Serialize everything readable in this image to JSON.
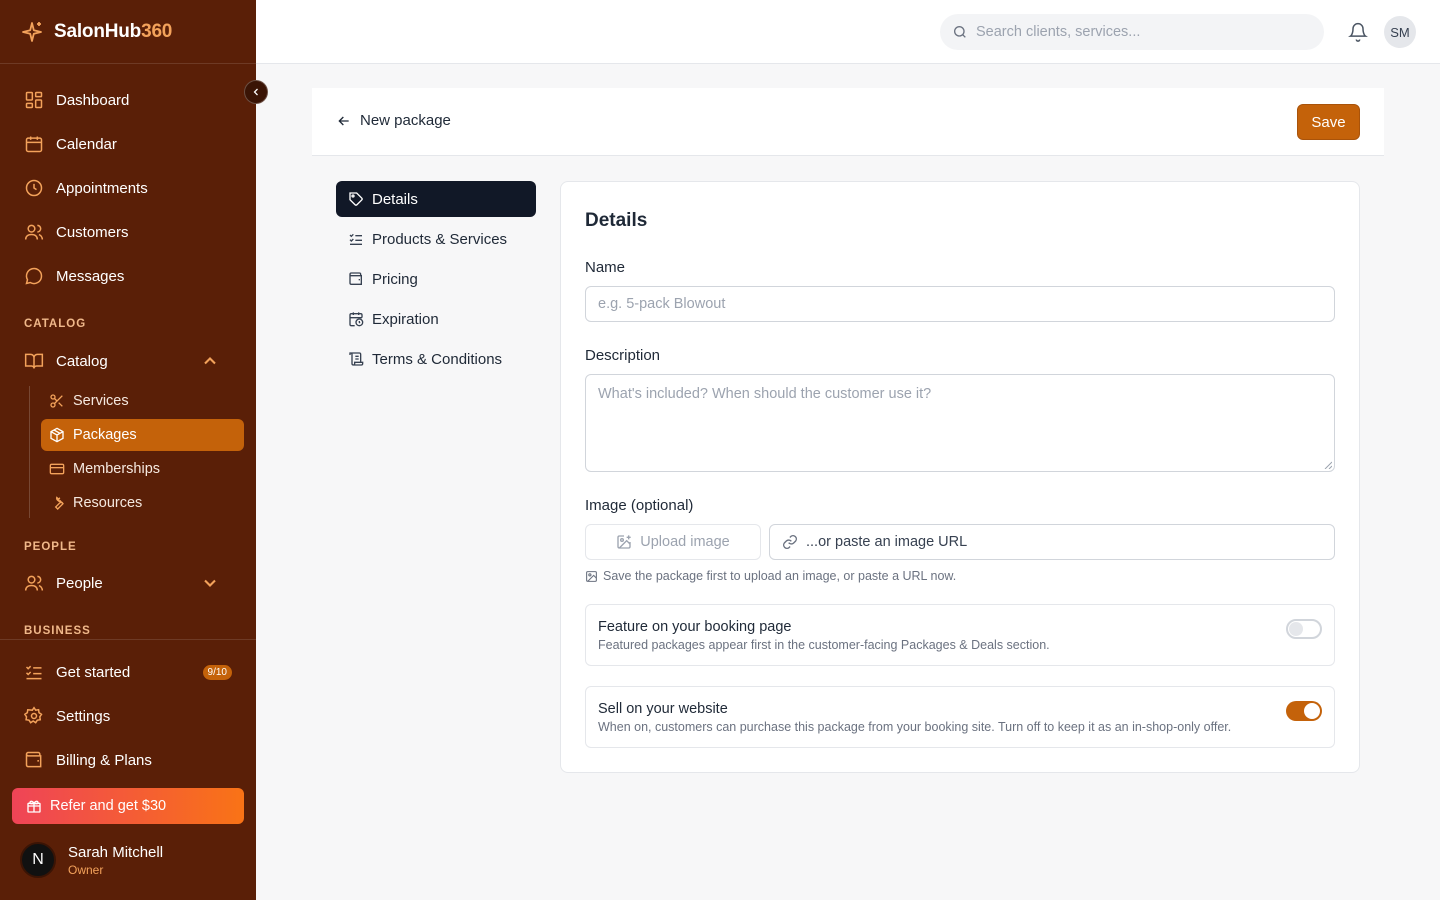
{
  "brand": {
    "name": "SalonHub",
    "suffix": "360"
  },
  "colors": {
    "sidebar": "#5a1f07",
    "accent": "#c4620a",
    "active_tab": "#111827",
    "refer_gradient": [
      "#ef4457",
      "#f97316"
    ]
  },
  "sidebar": {
    "main": [
      {
        "label": "Dashboard",
        "icon": "grid-icon"
      },
      {
        "label": "Calendar",
        "icon": "calendar-icon"
      },
      {
        "label": "Appointments",
        "icon": "clock-icon"
      },
      {
        "label": "Customers",
        "icon": "users-icon"
      },
      {
        "label": "Messages",
        "icon": "message-icon"
      }
    ],
    "catalog_section": "CATALOG",
    "catalog_label": "Catalog",
    "catalog_sub": [
      {
        "label": "Services",
        "icon": "scissors-icon"
      },
      {
        "label": "Packages",
        "icon": "package-icon",
        "active": true
      },
      {
        "label": "Memberships",
        "icon": "card-icon"
      },
      {
        "label": "Resources",
        "icon": "wrench-icon"
      }
    ],
    "people_section": "PEOPLE",
    "people_label": "People",
    "business_section": "BUSINESS",
    "business": [
      {
        "label": "Get started",
        "icon": "checklist-icon",
        "badge": "9/10"
      },
      {
        "label": "Settings",
        "icon": "gear-icon"
      },
      {
        "label": "Billing & Plans",
        "icon": "wallet-icon"
      }
    ],
    "refer": "Refer and get $30",
    "user": {
      "initial": "N",
      "name": "Sarah Mitchell",
      "role": "Owner"
    }
  },
  "topbar": {
    "search_placeholder": "Search clients, services...",
    "avatar": "SM"
  },
  "page": {
    "title": "New package",
    "save": "Save"
  },
  "tabs": [
    {
      "label": "Details",
      "icon": "tag-icon",
      "active": true
    },
    {
      "label": "Products & Services",
      "icon": "list-check-icon"
    },
    {
      "label": "Pricing",
      "icon": "wallet-icon"
    },
    {
      "label": "Expiration",
      "icon": "calendar-clock-icon"
    },
    {
      "label": "Terms & Conditions",
      "icon": "scroll-icon"
    }
  ],
  "form": {
    "heading": "Details",
    "name_label": "Name",
    "name_placeholder": "e.g. 5-pack Blowout",
    "desc_label": "Description",
    "desc_placeholder": "What's included? When should the customer use it?",
    "image_label": "Image (optional)",
    "upload": "Upload image",
    "url_placeholder": "...or paste an image URL",
    "hint": "Save the package first to upload an image, or paste a URL now.",
    "feature_title": "Feature on your booking page",
    "feature_desc": "Featured packages appear first in the customer-facing Packages & Deals section.",
    "feature_on": false,
    "sell_title": "Sell on your website",
    "sell_desc": "When on, customers can purchase this package from your booking site. Turn off to keep it as an in-shop-only offer.",
    "sell_on": true
  }
}
